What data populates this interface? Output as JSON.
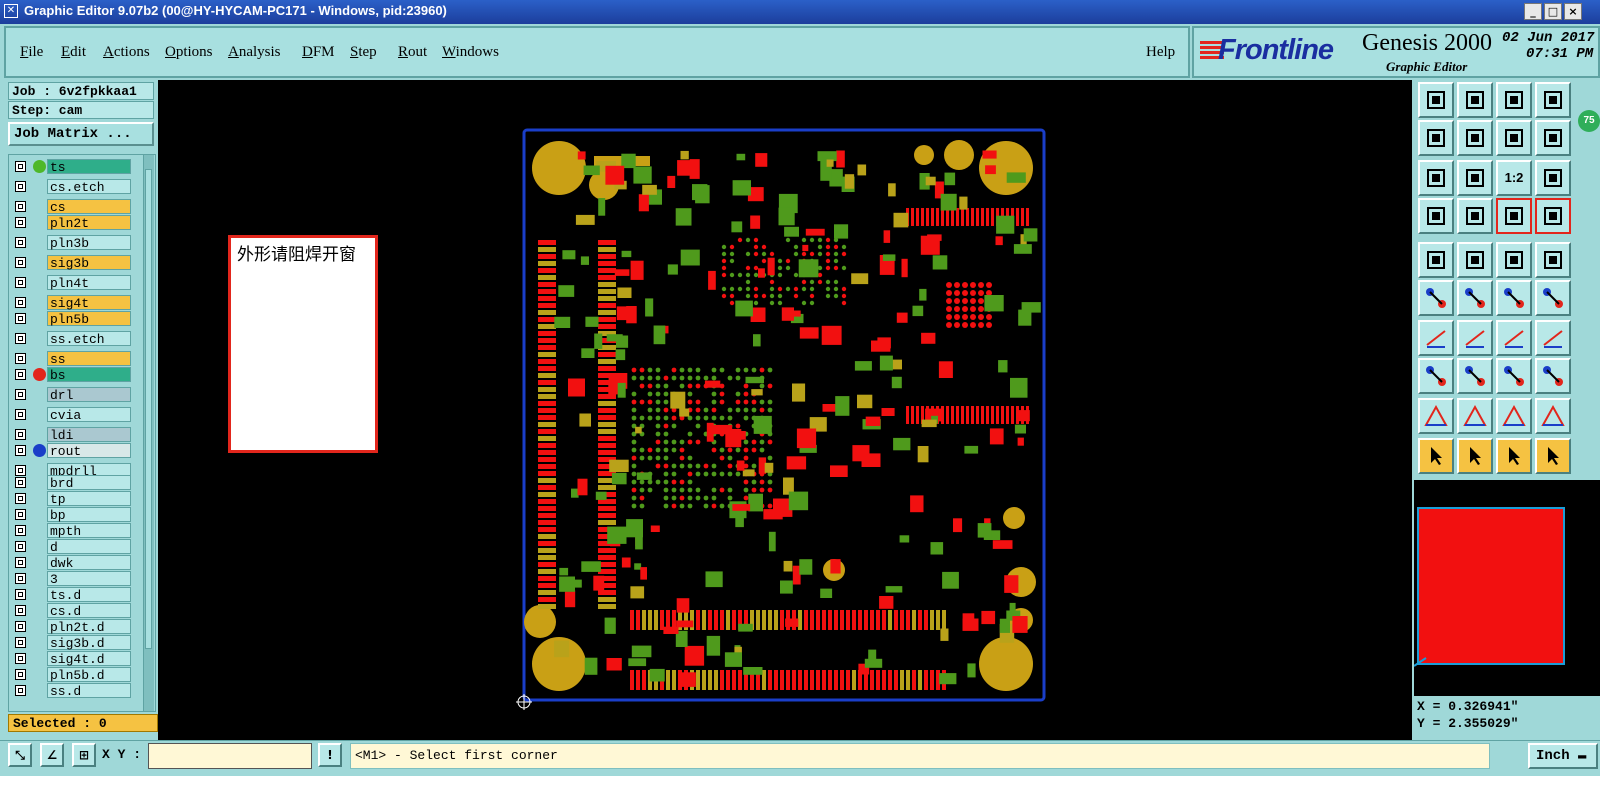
{
  "window": {
    "title": "Graphic Editor 9.07b2 (00@HY-HYCAM-PC171 - Windows, pid:23960)",
    "min_symbol": "_",
    "max_symbol": "□",
    "close_symbol": "×"
  },
  "menu": {
    "file": {
      "first": "F",
      "rest": "ile"
    },
    "edit": {
      "first": "E",
      "rest": "dit"
    },
    "actions": {
      "first": "A",
      "rest": "ctions"
    },
    "options": {
      "first": "O",
      "rest": "ptions"
    },
    "analysis": {
      "first": "A",
      "rest": "nalysis"
    },
    "dfm": {
      "first": "D",
      "rest": "FM"
    },
    "step": {
      "first": "S",
      "rest": "tep"
    },
    "rout": {
      "first": "R",
      "rest": "out"
    },
    "windows": {
      "first": "W",
      "rest": "indows"
    },
    "help": "Help"
  },
  "logo": {
    "brand": "Frontline",
    "product": "Genesis 2000",
    "subtitle": "Graphic Editor",
    "date": "02 Jun 2017",
    "time": "07:31 PM"
  },
  "job": {
    "job_label": "Job : 6v2fpkkaa1",
    "step_label": "Step: cam",
    "matrix_button": "Job Matrix ..."
  },
  "layers": [
    {
      "name": "ts",
      "color": "#2fae8a",
      "dot": "#4fb82a"
    },
    {
      "name": "cs.etch",
      "color": "#b8e8e8",
      "dot": ""
    },
    {
      "name": "cs",
      "color": "#f5c242",
      "dot": ""
    },
    {
      "name": "pln2t",
      "color": "#f5c242",
      "dot": ""
    },
    {
      "name": "pln3b",
      "color": "#b8e8e8",
      "dot": ""
    },
    {
      "name": "sig3b",
      "color": "#f5c242",
      "dot": ""
    },
    {
      "name": "pln4t",
      "color": "#b8e8e8",
      "dot": ""
    },
    {
      "name": "sig4t",
      "color": "#f5c242",
      "dot": ""
    },
    {
      "name": "pln5b",
      "color": "#f5c242",
      "dot": ""
    },
    {
      "name": "ss.etch",
      "color": "#b8e8e8",
      "dot": ""
    },
    {
      "name": "ss",
      "color": "#f5c242",
      "dot": ""
    },
    {
      "name": "bs",
      "color": "#2fae8a",
      "dot": "#e2261c"
    },
    {
      "name": "drl",
      "color": "#aac8d0",
      "dot": ""
    },
    {
      "name": "cvia",
      "color": "#b8e8e8",
      "dot": ""
    },
    {
      "name": "ldi",
      "color": "#aac8d0",
      "dot": ""
    },
    {
      "name": "rout",
      "color": "#d8e8e8",
      "dot": "#1a3ec8"
    },
    {
      "name": "mpdrll",
      "color": "#b8e8e8",
      "dot": ""
    },
    {
      "name": "brd",
      "color": "#b8e8e8",
      "dot": ""
    },
    {
      "name": "tp",
      "color": "#b8e8e8",
      "dot": ""
    },
    {
      "name": "bp",
      "color": "#b8e8e8",
      "dot": ""
    },
    {
      "name": "mpth",
      "color": "#b8e8e8",
      "dot": ""
    },
    {
      "name": "d",
      "color": "#b8e8e8",
      "dot": ""
    },
    {
      "name": "dwk",
      "color": "#b8e8e8",
      "dot": ""
    },
    {
      "name": "3",
      "color": "#b8e8e8",
      "dot": ""
    },
    {
      "name": "ts.d",
      "color": "#b8e8e8",
      "dot": ""
    },
    {
      "name": "cs.d",
      "color": "#b8e8e8",
      "dot": ""
    },
    {
      "name": "pln2t.d",
      "color": "#b8e8e8",
      "dot": ""
    },
    {
      "name": "sig3b.d",
      "color": "#b8e8e8",
      "dot": ""
    },
    {
      "name": "sig4t.d",
      "color": "#b8e8e8",
      "dot": ""
    },
    {
      "name": "pln5b.d",
      "color": "#b8e8e8",
      "dot": ""
    },
    {
      "name": "ss.d",
      "color": "#b8e8e8",
      "dot": ""
    }
  ],
  "selected_label": "Selected : 0",
  "note_text": "外形请阻焊开窗",
  "tool_preview_badge": "75",
  "tool_ratio_label": "1:2",
  "coords": {
    "x": "X = 0.326941\"",
    "y": "Y = 2.355029\""
  },
  "bottom": {
    "xy_label": "X Y :",
    "xy_value": "",
    "status_icon": "!",
    "status_text": "<M1> - Select first corner",
    "units": "Inch"
  },
  "colors": {
    "board_outline": "#1a3ec8",
    "green_layer": "#4f9a1c",
    "red_layer": "#f21010",
    "pad_gold": "#c9a015",
    "mixed": "#b9a21a"
  }
}
